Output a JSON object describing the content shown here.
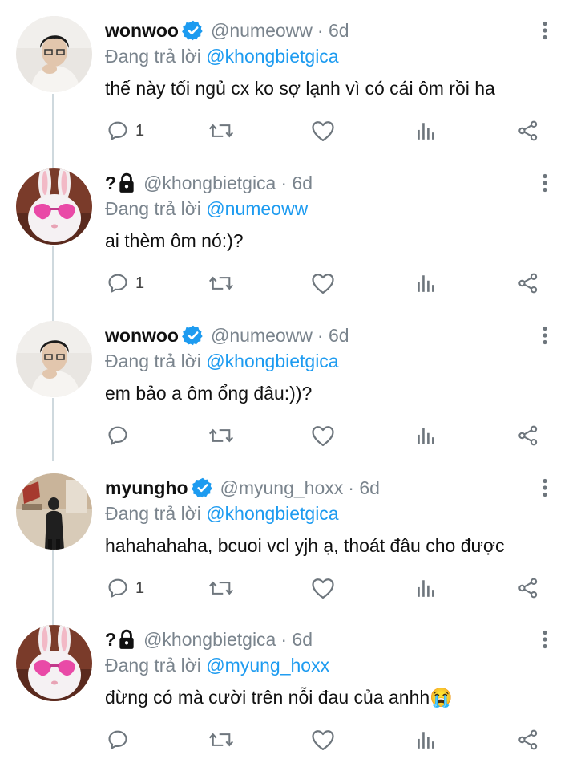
{
  "reply_prefix": "Đang trả lời",
  "tweets": [
    {
      "name": "wonwoo",
      "verified": true,
      "handle": "@numeoww",
      "time": "· 6d",
      "reply_to": "@khongbietgica",
      "text": "thế này tối ngủ cx ko sợ lạnh vì có cái ôm rồi ha",
      "reply_count": "1"
    },
    {
      "name": "?",
      "locked": true,
      "handle": "@khongbietgica",
      "time": "· 6d",
      "reply_to": "@numeoww",
      "text": "ai thèm ôm nó:)?",
      "reply_count": "1"
    },
    {
      "name": "wonwoo",
      "verified": true,
      "handle": "@numeoww",
      "time": "· 6d",
      "reply_to": "@khongbietgica",
      "text": "em bảo a ôm ổng đâu:))?",
      "reply_count": ""
    },
    {
      "name": "myungho",
      "verified": true,
      "handle": "@myung_hoxx",
      "time": "· 6d",
      "reply_to": "@khongbietgica",
      "text": "hahahahaha, bcuoi vcl yjh ạ, thoát đâu cho được",
      "reply_count": "1"
    },
    {
      "name": "?",
      "locked": true,
      "handle": "@khongbietgica",
      "time": "· 6d",
      "reply_to": "@myung_hoxx",
      "text": "đừng có mà cười trên nỗi đau của anhh😭",
      "reply_count": ""
    }
  ],
  "colors": {
    "accent": "#1d9bf0",
    "muted": "#7a848d",
    "thread_line": "#cfd9de"
  }
}
